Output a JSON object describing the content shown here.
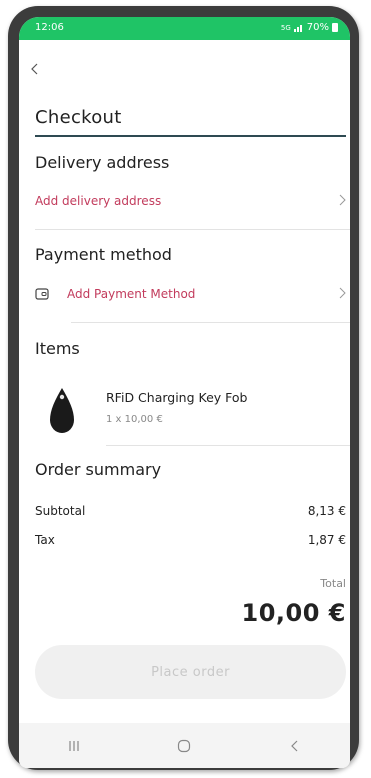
{
  "status_bar": {
    "time": "12:06",
    "network": "5G",
    "battery": "70%",
    "color": "#1fc466"
  },
  "header": {
    "back_icon": "chevron-left-icon",
    "title": "Checkout"
  },
  "delivery": {
    "heading": "Delivery address",
    "link_label": "Add delivery address"
  },
  "payment": {
    "heading": "Payment method",
    "link_label": "Add Payment Method",
    "icon": "wallet-icon"
  },
  "items": {
    "heading": "Items",
    "list": [
      {
        "name": "RFiD Charging Key Fob",
        "detail": "1 x 10,00 €",
        "icon": "key-fob-image"
      }
    ]
  },
  "summary": {
    "heading": "Order summary",
    "subtotal_label": "Subtotal",
    "subtotal_value": "8,13 €",
    "tax_label": "Tax",
    "tax_value": "1,87 €",
    "total_label": "Total",
    "total_value": "10,00 €"
  },
  "actions": {
    "place_order": "Place order"
  },
  "colors": {
    "accent_link": "#c23b5c",
    "title_underline": "#2e4a52"
  }
}
